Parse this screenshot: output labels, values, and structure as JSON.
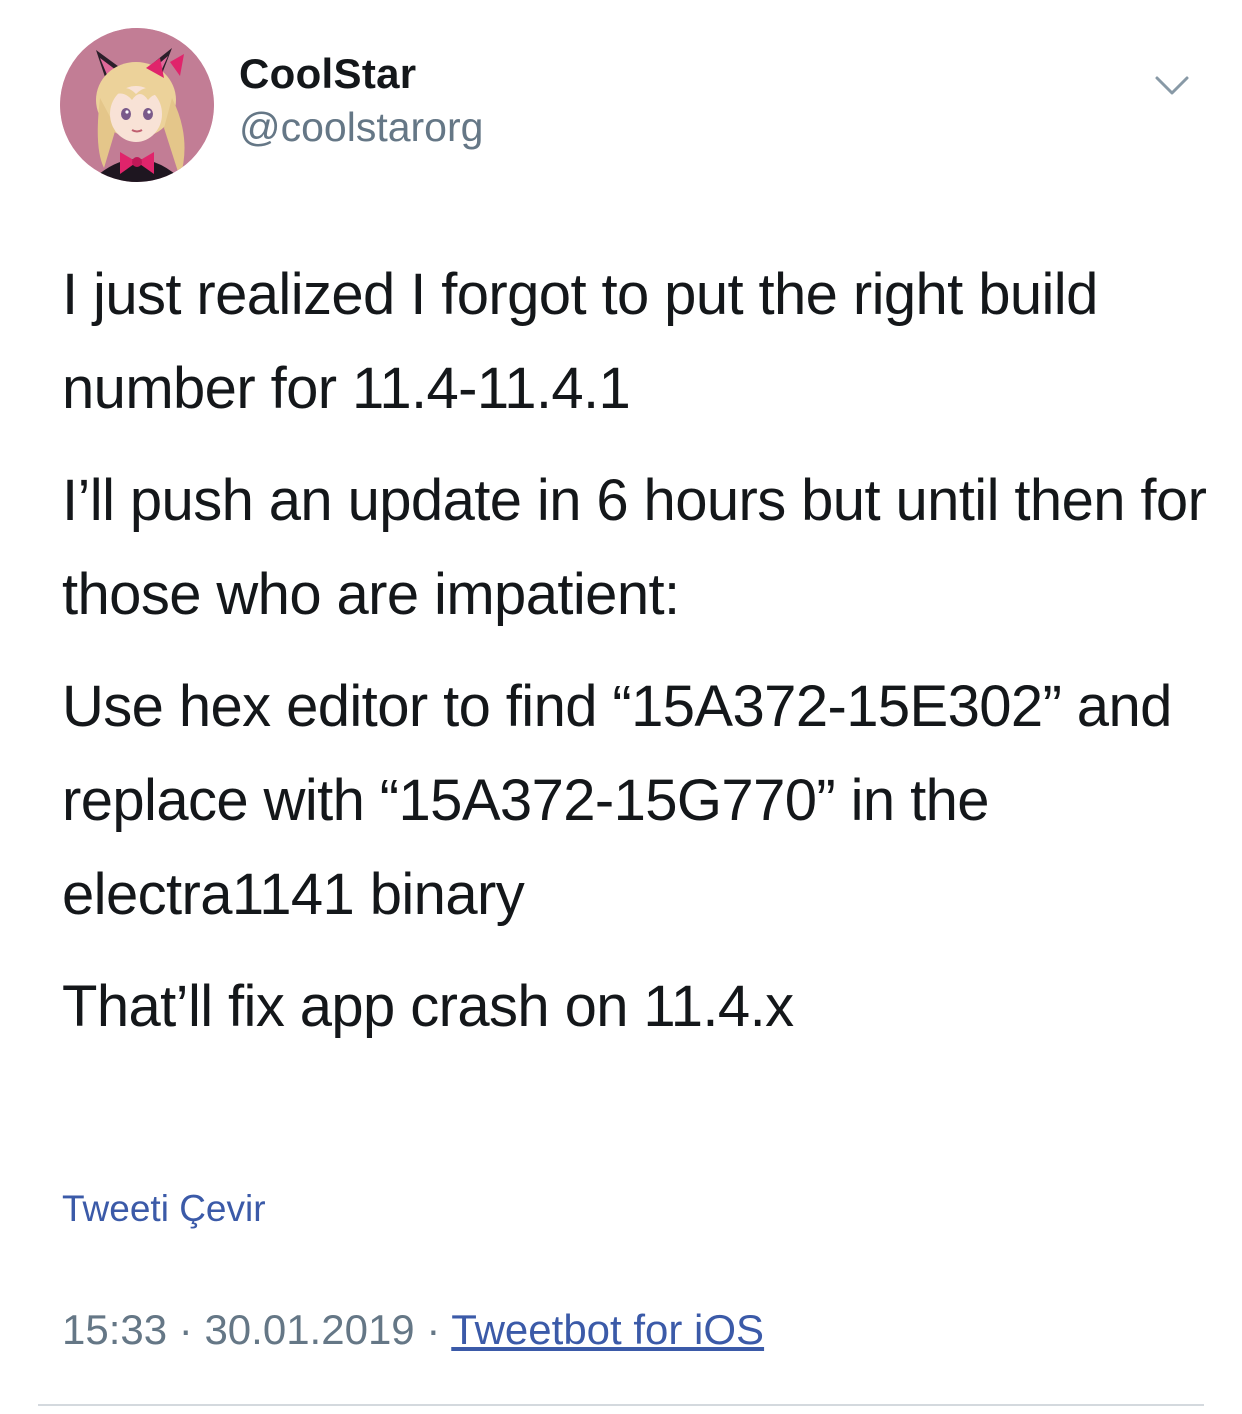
{
  "author": {
    "display_name": "CoolStar",
    "handle": "@coolstarorg",
    "avatar_icon": "anime-avatar-icon"
  },
  "menu": {
    "icon": "chevron-down-icon"
  },
  "tweet": {
    "paragraphs": [
      "I just realized I forgot to put the right build number for 11.4-11.4.1",
      "I’ll push an update in 6 hours but until then for those who are impatient:",
      "Use hex editor to find “15A372-15E302” and replace with “15A372-15G770” in the electra1141 binary",
      "That’ll fix app crash on 11.4.x"
    ]
  },
  "translate_label": "Tweeti Çevir",
  "meta": {
    "time": "15:33",
    "separator": "·",
    "date": "30.01.2019",
    "source": "Tweetbot for iOS"
  },
  "colors": {
    "text": "#14171a",
    "secondary": "#657786",
    "link": "#3b5aa8",
    "divider": "#d4d9de"
  }
}
